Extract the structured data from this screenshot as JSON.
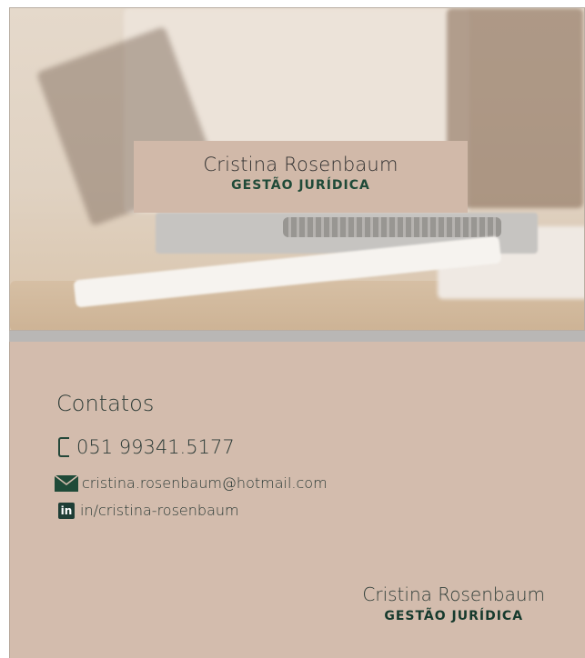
{
  "front": {
    "name": "Cristina Rosenbaum",
    "role": "GESTÃO JURÍDICA"
  },
  "back": {
    "contacts_title": "Contatos",
    "phone": "051 99341.5177",
    "email": "cristina.rosenbaum@hotmail.com",
    "linkedin_badge": "in",
    "linkedin": "in/cristina-rosenbaum",
    "name": "Cristina Rosenbaum",
    "role": "GESTÃO JURÍDICA"
  },
  "icons": {
    "phone": "phone-icon",
    "email": "mail-icon",
    "linkedin": "linkedin-icon"
  },
  "colors": {
    "card_background": "#d3bcad",
    "accent_green": "#1f4a38"
  }
}
